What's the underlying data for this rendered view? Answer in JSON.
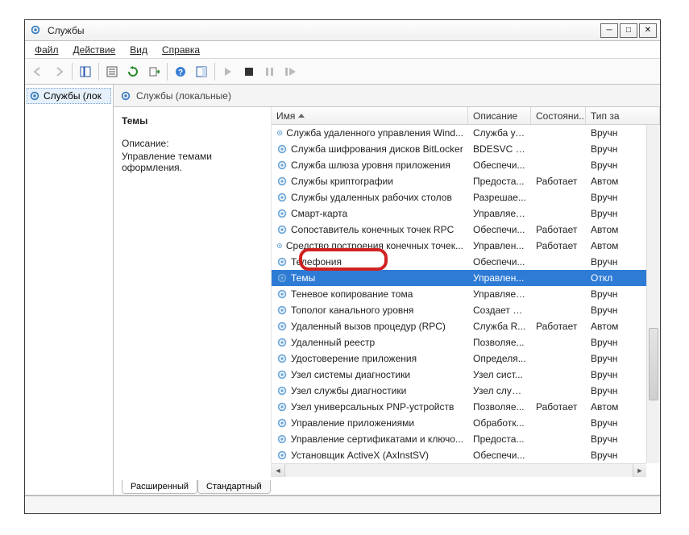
{
  "window": {
    "title": "Службы"
  },
  "menu": {
    "file": "Файл",
    "action": "Действие",
    "view": "Вид",
    "help": "Справка"
  },
  "tree": {
    "root": "Службы (лок"
  },
  "panel": {
    "heading": "Службы (локальные)"
  },
  "detail": {
    "selected_name": "Темы",
    "desc_label": "Описание:",
    "desc_text": "Управление темами оформления."
  },
  "columns": {
    "name": "Имя",
    "desc": "Описание",
    "state": "Состояни...",
    "type": "Тип за"
  },
  "tabs": {
    "ext": "Расширенный",
    "std": "Стандартный"
  },
  "rows": [
    {
      "name": "Служба удаленного управления Wind...",
      "desc": "Служба уд...",
      "state": "",
      "type": "Вручн"
    },
    {
      "name": "Служба шифрования дисков BitLocker",
      "desc": "BDESVC пр...",
      "state": "",
      "type": "Вручн"
    },
    {
      "name": "Служба шлюза уровня приложения",
      "desc": "Обеспечи...",
      "state": "",
      "type": "Вручн"
    },
    {
      "name": "Службы криптографии",
      "desc": "Предоста...",
      "state": "Работает",
      "type": "Автом"
    },
    {
      "name": "Службы удаленных рабочих столов",
      "desc": "Разрешае...",
      "state": "",
      "type": "Вручн"
    },
    {
      "name": "Смарт-карта",
      "desc": "Управляет...",
      "state": "",
      "type": "Вручн"
    },
    {
      "name": "Сопоставитель конечных точек RPC",
      "desc": "Обеспечи...",
      "state": "Работает",
      "type": "Автом"
    },
    {
      "name": "Средство построения конечных точек...",
      "desc": "Управлен...",
      "state": "Работает",
      "type": "Автом"
    },
    {
      "name": "Телефония",
      "desc": "Обеспечи...",
      "state": "",
      "type": "Вручн"
    },
    {
      "name": "Темы",
      "desc": "Управлен...",
      "state": "",
      "type": "Откл",
      "selected": true
    },
    {
      "name": "Теневое копирование тома",
      "desc": "Управляет...",
      "state": "",
      "type": "Вручн"
    },
    {
      "name": "Тополог канального уровня",
      "desc": "Создает ка...",
      "state": "",
      "type": "Вручн"
    },
    {
      "name": "Удаленный вызов процедур (RPC)",
      "desc": "Служба R...",
      "state": "Работает",
      "type": "Автом"
    },
    {
      "name": "Удаленный реестр",
      "desc": "Позволяе...",
      "state": "",
      "type": "Вручн"
    },
    {
      "name": "Удостоверение приложения",
      "desc": "Определя...",
      "state": "",
      "type": "Вручн"
    },
    {
      "name": "Узел системы диагностики",
      "desc": "Узел сист...",
      "state": "",
      "type": "Вручн"
    },
    {
      "name": "Узел службы диагностики",
      "desc": "Узел служ...",
      "state": "",
      "type": "Вручн"
    },
    {
      "name": "Узел универсальных PNP-устройств",
      "desc": "Позволяе...",
      "state": "Работает",
      "type": "Автом"
    },
    {
      "name": "Управление приложениями",
      "desc": "Обработк...",
      "state": "",
      "type": "Вручн"
    },
    {
      "name": "Управление сертификатами и ключо...",
      "desc": "Предоста...",
      "state": "",
      "type": "Вручн"
    },
    {
      "name": "Установщик ActiveX (AxInstSV)",
      "desc": "Обеспечи...",
      "state": "",
      "type": "Вручн"
    }
  ]
}
